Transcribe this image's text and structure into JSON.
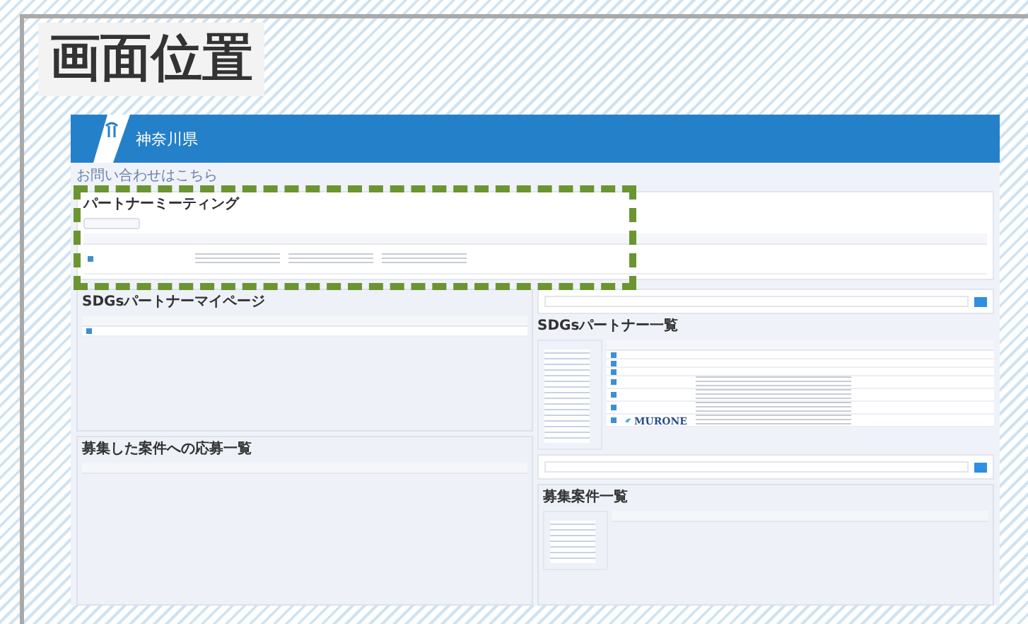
{
  "label": "画面位置",
  "header": {
    "brand": "神奈川県"
  },
  "contact_link": "お問い合わせはこちら",
  "meeting": {
    "title": "パートナーミーティング"
  },
  "mypage": {
    "title": "SDGsパートナーマイページ"
  },
  "applications": {
    "title": "募集した案件への応募一覧"
  },
  "partner_list": {
    "title": "SDGsパートナー一覧",
    "rows": [
      {
        "kind": "plain"
      },
      {
        "kind": "plain"
      },
      {
        "kind": "plain"
      },
      {
        "kind": "plain"
      },
      {
        "kind": "plain"
      },
      {
        "kind": "plain"
      },
      {
        "kind": "logo",
        "logo": "MURONE"
      }
    ]
  },
  "recruit_list": {
    "title": "募集案件一覧"
  }
}
